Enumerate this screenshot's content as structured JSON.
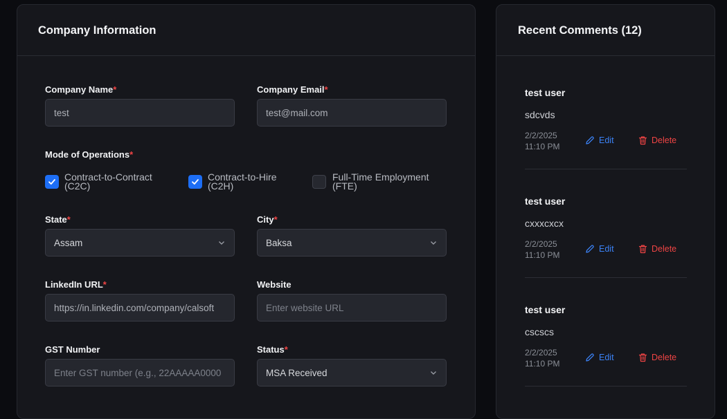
{
  "company_panel": {
    "title": "Company Information",
    "company_name": {
      "label": "Company Name",
      "value": "test"
    },
    "company_email": {
      "label": "Company Email",
      "value": "test@mail.com"
    },
    "mode": {
      "label": "Mode of Operations",
      "options": [
        {
          "label": "Contract-to-Contract (C2C)",
          "checked": true
        },
        {
          "label": "Contract-to-Hire (C2H)",
          "checked": true
        },
        {
          "label": "Full-Time Employment (FTE)",
          "checked": false
        }
      ]
    },
    "state": {
      "label": "State",
      "value": "Assam"
    },
    "city": {
      "label": "City",
      "value": "Baksa"
    },
    "linkedin": {
      "label": "LinkedIn URL",
      "value": "https://in.linkedin.com/company/calsoft"
    },
    "website": {
      "label": "Website",
      "placeholder": "Enter website URL"
    },
    "gst": {
      "label": "GST Number",
      "placeholder": "Enter GST number (e.g., 22AAAAA0000"
    },
    "status": {
      "label": "Status",
      "value": "MSA Received"
    },
    "required_marker": "*"
  },
  "comments_panel": {
    "title": "Recent Comments (12)",
    "edit_label": "Edit",
    "delete_label": "Delete",
    "comments": [
      {
        "user": "test user",
        "text": "sdcvds",
        "date": "2/2/2025",
        "time": "11:10 PM"
      },
      {
        "user": "test user",
        "text": "cxxxcxcx",
        "date": "2/2/2025",
        "time": "11:10 PM"
      },
      {
        "user": "test user",
        "text": "cscscs",
        "date": "2/2/2025",
        "time": "11:10 PM"
      }
    ]
  },
  "colors": {
    "accent": "#1d6ef5",
    "required": "#ef4444",
    "edit": "#3b82f6",
    "delete": "#ef4444"
  },
  "icons": [
    "chevron-down-icon",
    "check-icon",
    "pencil-icon",
    "trash-icon"
  ]
}
